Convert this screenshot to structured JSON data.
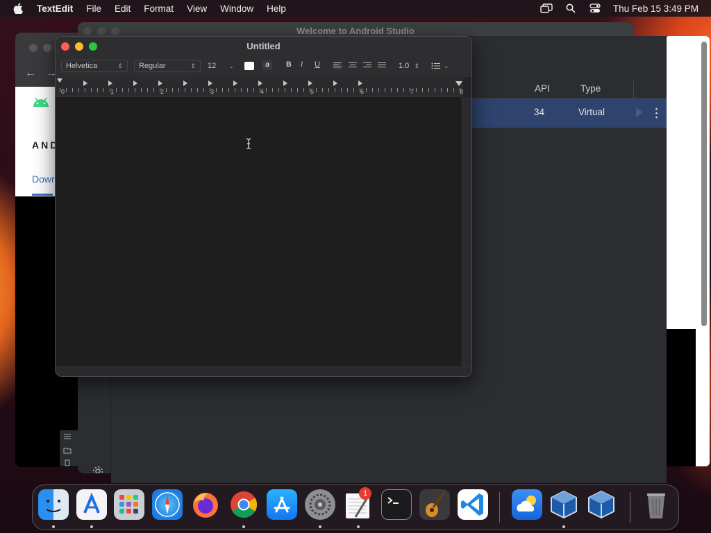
{
  "menubar": {
    "app_name": "TextEdit",
    "menus": [
      "File",
      "Edit",
      "Format",
      "View",
      "Window",
      "Help"
    ],
    "clock": "Thu Feb 15  3:49 PM"
  },
  "browser": {
    "heading_partial": "AND",
    "link_partial": "Dowr"
  },
  "studio": {
    "title": "Welcome to Android Studio"
  },
  "device_manager": {
    "columns": [
      "API",
      "Type"
    ],
    "rows": [
      {
        "api": "34",
        "type": "Virtual"
      }
    ]
  },
  "textedit": {
    "title": "Untitled",
    "font_family": "Helvetica",
    "font_style": "Regular",
    "font_size": "12",
    "bold_label": "B",
    "italic_label": "I",
    "underline_label": "U",
    "line_spacing": "1.0",
    "ruler_numbers": [
      "0",
      "1",
      "2",
      "3",
      "4",
      "5",
      "6",
      "7",
      "8"
    ]
  },
  "dock": {
    "items": [
      "Finder",
      "Xcode",
      "Launchpad",
      "Safari",
      "Firefox",
      "Chrome",
      "App Store",
      "System Settings",
      "TextEdit",
      "Terminal",
      "GarageBand",
      "Visual Studio Code",
      "Weather",
      "VirtualBox",
      "VirtualBox VM",
      "Trash"
    ],
    "settings_badge": "1"
  },
  "colors": {
    "close": "#fe5f57",
    "minimize": "#febc2e",
    "zoom": "#28c840",
    "selection_row": "#2e436e"
  }
}
